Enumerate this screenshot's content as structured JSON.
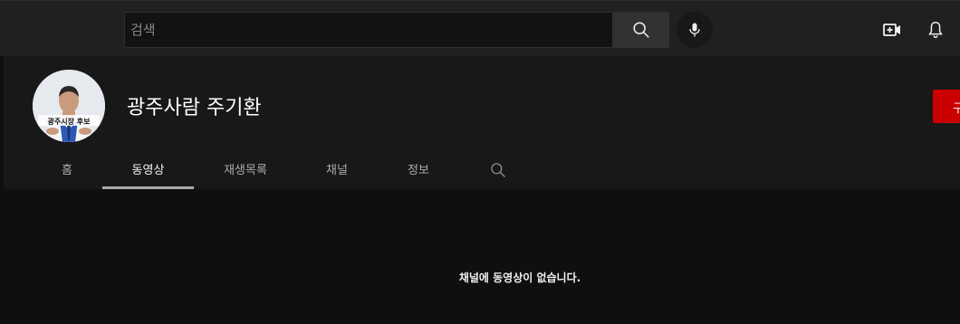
{
  "search": {
    "placeholder": "검색"
  },
  "channel": {
    "name": "광주사람 주기환",
    "avatar_caption": "광주시장 후보",
    "subscribe_label": "구"
  },
  "tabs": [
    {
      "label": "홈",
      "active": false
    },
    {
      "label": "동영상",
      "active": true
    },
    {
      "label": "재생목록",
      "active": false
    },
    {
      "label": "채널",
      "active": false
    },
    {
      "label": "정보",
      "active": false
    }
  ],
  "content": {
    "empty_message": "채널에 동영상이 없습니다."
  },
  "icons": {
    "search": "search-icon",
    "mic": "mic-icon",
    "create": "video-create-icon",
    "notifications": "bell-icon",
    "channel_search": "search-icon"
  },
  "colors": {
    "accent_red": "#cc0000",
    "active_tab_underline": "#aaaaaa"
  }
}
